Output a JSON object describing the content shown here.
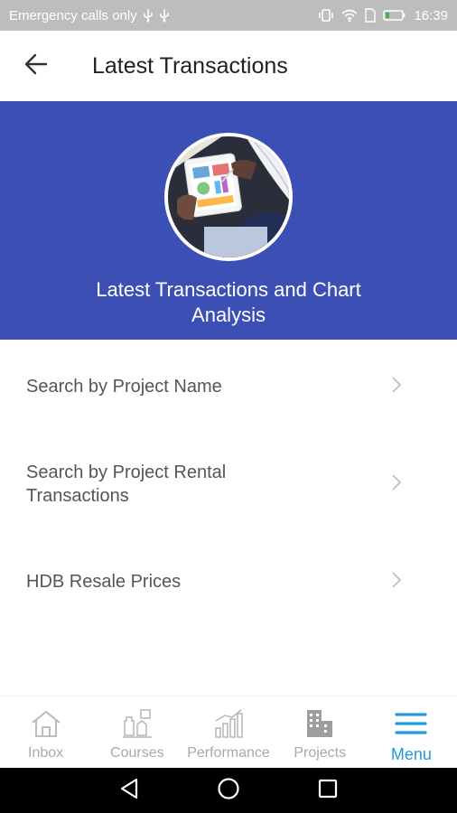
{
  "status_bar": {
    "carrier_text": "Emergency calls only",
    "time": "16:39",
    "icons": [
      "usb-icon",
      "usb-icon",
      "vibrate-icon",
      "wifi-icon",
      "sim-icon",
      "battery-icon"
    ]
  },
  "app_bar": {
    "title": "Latest Transactions",
    "back_icon": "arrow-left-icon"
  },
  "banner": {
    "title": "Latest Transactions and Chart Analysis",
    "background": "#3c4fb4"
  },
  "list": {
    "items": [
      {
        "label": "Search by Project Name",
        "icon": "chevron-right-icon"
      },
      {
        "label": "Search by Project Rental Transactions",
        "icon": "chevron-right-icon"
      },
      {
        "label": "HDB Resale Prices",
        "icon": "chevron-right-icon"
      }
    ]
  },
  "bottom_nav": {
    "items": [
      {
        "label": "Inbox",
        "icon": "home-icon",
        "active": false
      },
      {
        "label": "Courses",
        "icon": "chess-icon",
        "active": false
      },
      {
        "label": "Performance",
        "icon": "bar-chart-icon",
        "active": false
      },
      {
        "label": "Projects",
        "icon": "building-icon",
        "active": false
      },
      {
        "label": "Menu",
        "icon": "hamburger-menu-icon",
        "active": true
      }
    ],
    "active_color": "#1e9be0",
    "inactive_color": "#a9a9a9"
  },
  "system_nav": {
    "buttons": [
      "back-triangle-icon",
      "home-circle-icon",
      "recents-square-icon"
    ]
  }
}
